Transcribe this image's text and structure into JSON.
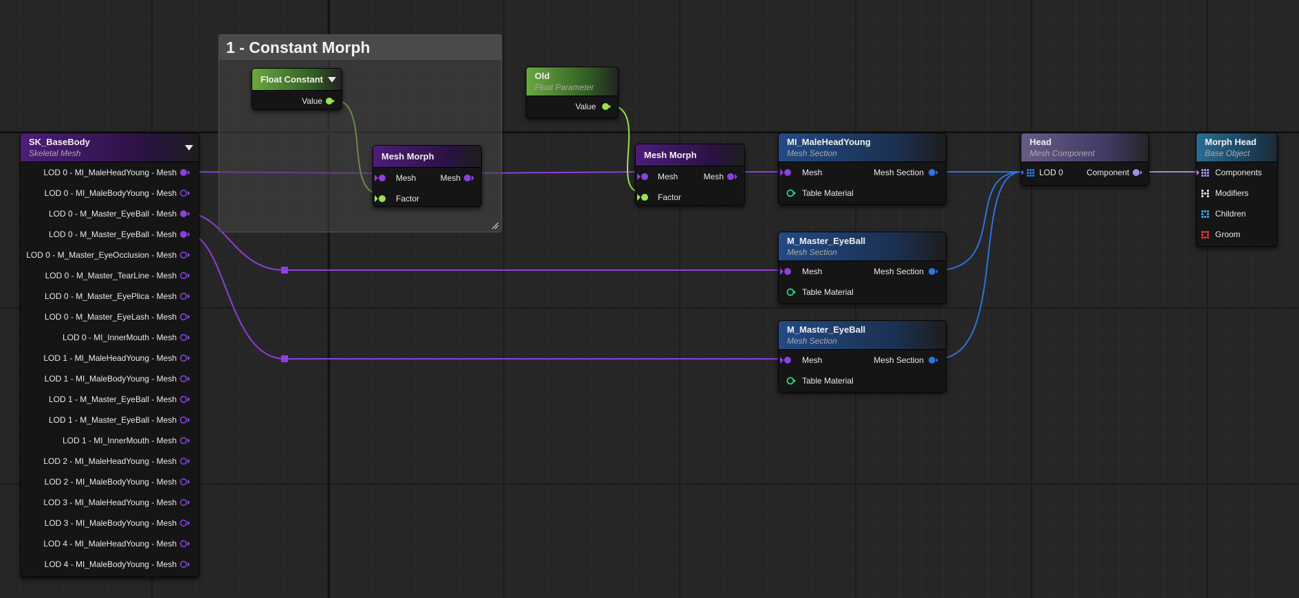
{
  "comment": {
    "title": "1 - Constant Morph"
  },
  "skeletal": {
    "title": "SK_BaseBody",
    "subtitle": "Skeletal Mesh",
    "pins": [
      "LOD 0 - MI_MaleHeadYoung - Mesh",
      "LOD 0 - MI_MaleBodyYoung - Mesh",
      "LOD 0 - M_Master_EyeBall - Mesh",
      "LOD 0 - M_Master_EyeBall - Mesh",
      "LOD 0 - M_Master_EyeOcclusion - Mesh",
      "LOD 0 - M_Master_TearLine - Mesh",
      "LOD 0 - M_Master_EyePlica - Mesh",
      "LOD 0 - M_Master_EyeLash - Mesh",
      "LOD 0 - MI_InnerMouth - Mesh",
      "LOD 1 - MI_MaleHeadYoung - Mesh",
      "LOD 1 - MI_MaleBodyYoung - Mesh",
      "LOD 1 - M_Master_EyeBall - Mesh",
      "LOD 1 - M_Master_EyeBall - Mesh",
      "LOD 1 - MI_InnerMouth - Mesh",
      "LOD 2 - MI_MaleHeadYoung - Mesh",
      "LOD 2 - MI_MaleBodyYoung - Mesh",
      "LOD 3 - MI_MaleHeadYoung - Mesh",
      "LOD 3 - MI_MaleBodyYoung - Mesh",
      "LOD 4 - MI_MaleHeadYoung - Mesh",
      "LOD 4 - MI_MaleBodyYoung - Mesh"
    ]
  },
  "float_constant": {
    "title": "Float Constant",
    "value_label": "Value"
  },
  "mesh_morph_1": {
    "title": "Mesh Morph",
    "in_mesh": "Mesh",
    "out_mesh": "Mesh",
    "factor": "Factor"
  },
  "float_param": {
    "title": "Old",
    "subtitle": "Float Parameter",
    "value_label": "Value"
  },
  "mesh_morph_2": {
    "title": "Mesh Morph",
    "in_mesh": "Mesh",
    "out_mesh": "Mesh",
    "factor": "Factor"
  },
  "section_1": {
    "title": "MI_MaleHeadYoung",
    "subtitle": "Mesh Section",
    "mesh": "Mesh",
    "out": "Mesh Section",
    "material": "Table Material"
  },
  "section_2": {
    "title": "M_Master_EyeBall",
    "subtitle": "Mesh Section",
    "mesh": "Mesh",
    "out": "Mesh Section",
    "material": "Table Material"
  },
  "section_3": {
    "title": "M_Master_EyeBall",
    "subtitle": "Mesh Section",
    "mesh": "Mesh",
    "out": "Mesh Section",
    "material": "Table Material"
  },
  "head": {
    "title": "Head",
    "subtitle": "Mesh Component",
    "lod": "LOD 0",
    "out": "Component"
  },
  "morph_head": {
    "title": "Morph Head",
    "subtitle": "Base Object",
    "components": "Components",
    "modifiers": "Modifiers",
    "children": "Children",
    "groom": "Groom"
  },
  "colors": {
    "mesh_pin": "#8d3fe0",
    "float_pin": "#9be34e",
    "section_pin": "#2f73e0",
    "component_pin": "#a58ae8",
    "material_pin": "#2bd07d",
    "groom_pin": "#e03a3a",
    "modifiers_pin": "#d8d8d8",
    "children_pin": "#2fa0e8"
  }
}
